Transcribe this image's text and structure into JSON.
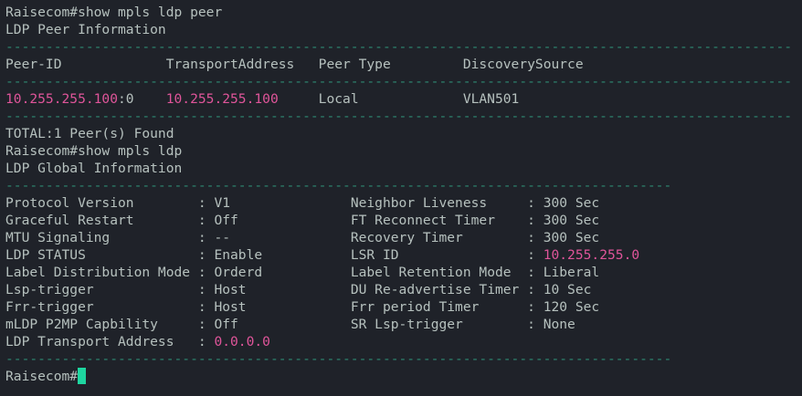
{
  "theme": {
    "background": "#1f2229",
    "text": "#b6c1be",
    "highlight": "#e0559a",
    "rule": "#2f8a73",
    "cursor": "#1ed6a0"
  },
  "peer_section": {
    "command": "Raisecom#show mpls ldp peer",
    "title": "LDP Peer Information",
    "rule": "--------------------------------------------------------------------------------------------------",
    "headers": [
      "Peer-ID",
      "TransportAddress",
      "Peer Type",
      "DiscoverySource"
    ],
    "row": {
      "peer_id": "10.255.255.100",
      "peer_id_suffix": ":0",
      "transport_address": "10.255.255.100",
      "peer_type": "Local",
      "discovery_source": "VLAN501"
    },
    "total": "TOTAL:1 Peer(s) Found"
  },
  "global_section": {
    "command": "Raisecom#show mpls ldp",
    "title": "LDP Global Information",
    "rule": "-----------------------------------------------------------------------------------",
    "rows": [
      {
        "left_label": "Protocol Version        : ",
        "left_value": "V1",
        "left_pink": false,
        "right_label": "Neighbor Liveness     : ",
        "right_value": "300 Sec",
        "right_pink": false
      },
      {
        "left_label": "Graceful Restart        : ",
        "left_value": "Off",
        "left_pink": false,
        "right_label": "FT Reconnect Timer    : ",
        "right_value": "300 Sec",
        "right_pink": false
      },
      {
        "left_label": "MTU Signaling           : ",
        "left_value": "--",
        "left_pink": false,
        "right_label": "Recovery Timer        : ",
        "right_value": "300 Sec",
        "right_pink": false
      },
      {
        "left_label": "LDP STATUS              : ",
        "left_value": "Enable",
        "left_pink": false,
        "right_label": "LSR ID                : ",
        "right_value": "10.255.255.0",
        "right_pink": true
      },
      {
        "left_label": "Label Distribution Mode : ",
        "left_value": "Orderd",
        "left_pink": false,
        "right_label": "Label Retention Mode  : ",
        "right_value": "Liberal",
        "right_pink": false
      },
      {
        "left_label": "Lsp-trigger             : ",
        "left_value": "Host",
        "left_pink": false,
        "right_label": "DU Re-advertise Timer : ",
        "right_value": "10 Sec",
        "right_pink": false
      },
      {
        "left_label": "Frr-trigger             : ",
        "left_value": "Host",
        "left_pink": false,
        "right_label": "Frr period Timer      : ",
        "right_value": "120 Sec",
        "right_pink": false
      },
      {
        "left_label": "mLDP P2MP Capbility     : ",
        "left_value": "Off",
        "left_pink": false,
        "right_label": "SR Lsp-trigger        : ",
        "right_value": "None",
        "right_pink": false
      }
    ],
    "transport_label": "LDP Transport Address   : ",
    "transport_value": "0.0.0.0"
  },
  "prompt": "Raisecom#"
}
